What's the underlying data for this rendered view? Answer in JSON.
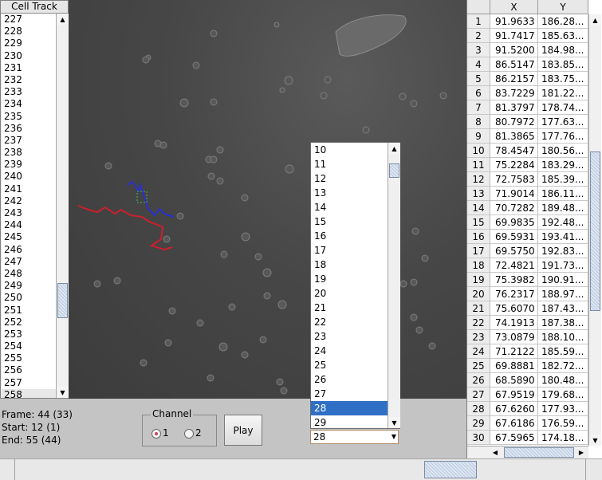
{
  "cell_track": {
    "title": "Cell Track",
    "items": [
      "227",
      "228",
      "229",
      "230",
      "231",
      "232",
      "233",
      "234",
      "235",
      "236",
      "237",
      "238",
      "239",
      "240",
      "241",
      "242",
      "243",
      "244",
      "245",
      "246",
      "247",
      "248",
      "249",
      "250",
      "251",
      "252",
      "253",
      "254",
      "255",
      "256",
      "257",
      "258"
    ],
    "selected": "258"
  },
  "frame_dropdown": {
    "options": [
      "10",
      "11",
      "12",
      "13",
      "14",
      "15",
      "16",
      "17",
      "18",
      "19",
      "20",
      "21",
      "22",
      "23",
      "24",
      "25",
      "26",
      "27",
      "28",
      "29"
    ],
    "selected": "28",
    "value": "28"
  },
  "status": {
    "frame": "Frame: 44 (33)",
    "start": "Start: 12 (1)",
    "end": "End: 55 (44)"
  },
  "channel": {
    "legend": "Channel",
    "option1": "1",
    "option2": "2",
    "selected": "1"
  },
  "play_label": "Play",
  "table": {
    "columns": [
      "",
      "X",
      "Y"
    ],
    "rows": [
      [
        "1",
        "91.9633",
        "186.28..."
      ],
      [
        "2",
        "91.7417",
        "185.63..."
      ],
      [
        "3",
        "91.5200",
        "184.98..."
      ],
      [
        "4",
        "86.5147",
        "183.85..."
      ],
      [
        "5",
        "86.2157",
        "183.75..."
      ],
      [
        "6",
        "83.7229",
        "181.22..."
      ],
      [
        "7",
        "81.3797",
        "178.74..."
      ],
      [
        "8",
        "80.7972",
        "177.63..."
      ],
      [
        "9",
        "81.3865",
        "177.76..."
      ],
      [
        "10",
        "78.4547",
        "180.56..."
      ],
      [
        "11",
        "75.2284",
        "183.29..."
      ],
      [
        "12",
        "72.7583",
        "185.39..."
      ],
      [
        "13",
        "71.9014",
        "186.11..."
      ],
      [
        "14",
        "70.7282",
        "189.48..."
      ],
      [
        "15",
        "69.9835",
        "192.48..."
      ],
      [
        "16",
        "69.5931",
        "193.41..."
      ],
      [
        "17",
        "69.5750",
        "192.83..."
      ],
      [
        "18",
        "72.4821",
        "191.73..."
      ],
      [
        "19",
        "75.3982",
        "190.91..."
      ],
      [
        "20",
        "76.2317",
        "188.97..."
      ],
      [
        "21",
        "75.6070",
        "187.43..."
      ],
      [
        "22",
        "74.1913",
        "187.38..."
      ],
      [
        "23",
        "73.0879",
        "188.10..."
      ],
      [
        "24",
        "71.2122",
        "185.59..."
      ],
      [
        "25",
        "69.8881",
        "182.72..."
      ],
      [
        "26",
        "68.5890",
        "180.48..."
      ],
      [
        "27",
        "67.9519",
        "179.68..."
      ],
      [
        "28",
        "67.6260",
        "177.93..."
      ],
      [
        "29",
        "67.6186",
        "176.59..."
      ],
      [
        "30",
        "67.5965",
        "174.18..."
      ]
    ]
  },
  "colors": {
    "track_red": "#cc1f2e",
    "track_blue": "#2b2fd0",
    "selection_blue": "#2f6fc5",
    "box_green": "#3fbf3f"
  }
}
